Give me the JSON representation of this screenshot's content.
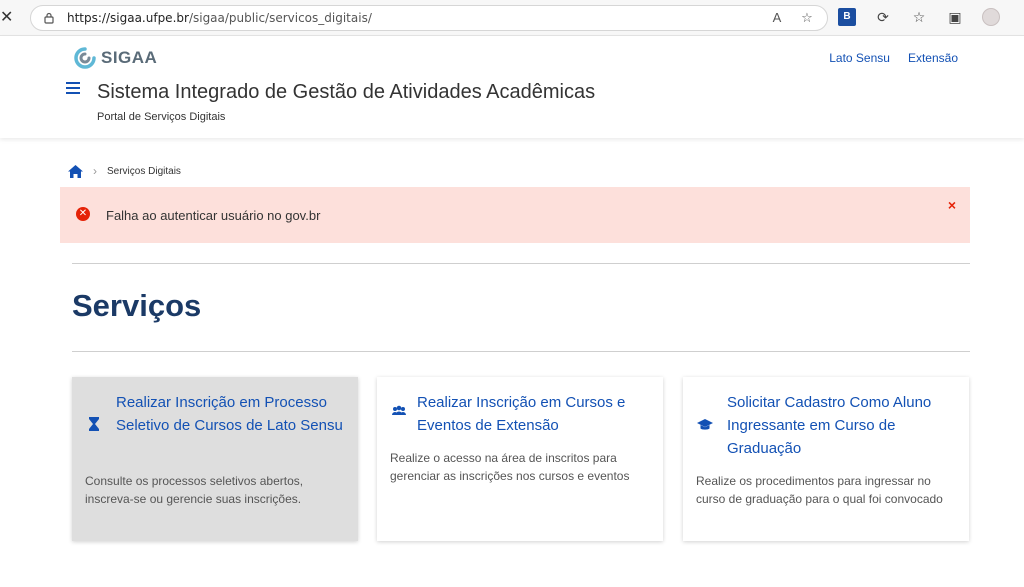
{
  "browser": {
    "url_host": "https://sigaa.ufpe.br",
    "url_path": "/sigaa/public/servicos_digitais/"
  },
  "header": {
    "logo_text": "SIGAA",
    "links": [
      "Lato Sensu",
      "Extensão"
    ],
    "system_title": "Sistema Integrado de Gestão de Atividades Acadêmicas",
    "subtitle": "Portal de Serviços Digitais"
  },
  "breadcrumb": {
    "current": "Serviços Digitais"
  },
  "alert": {
    "message": "Falha ao autenticar usuário no gov.br",
    "close_symbol": "×"
  },
  "section": {
    "title": "Serviços"
  },
  "cards": [
    {
      "icon": "hourglass-icon",
      "title": "Realizar Inscrição em Processo Seletivo de Cursos de Lato Sensu",
      "description": "Consulte os processos seletivos abertos, inscreva-se ou gerencie suas inscrições."
    },
    {
      "icon": "users-icon",
      "title": "Realizar Inscrição em Cursos e Eventos de Extensão",
      "description": "Realize o acesso na área de inscritos para gerenciar as inscrições nos cursos e eventos"
    },
    {
      "icon": "graduation-cap-icon",
      "title": "Solicitar Cadastro Como Aluno Ingressante em Curso de Graduação",
      "description": "Realize os procedimentos para ingressar no curso de graduação para o qual foi convocado"
    }
  ],
  "colors": {
    "link_blue": "#1351b4",
    "title_navy": "#1b3a66",
    "alert_bg": "#fde0db",
    "alert_red": "#e52207"
  }
}
